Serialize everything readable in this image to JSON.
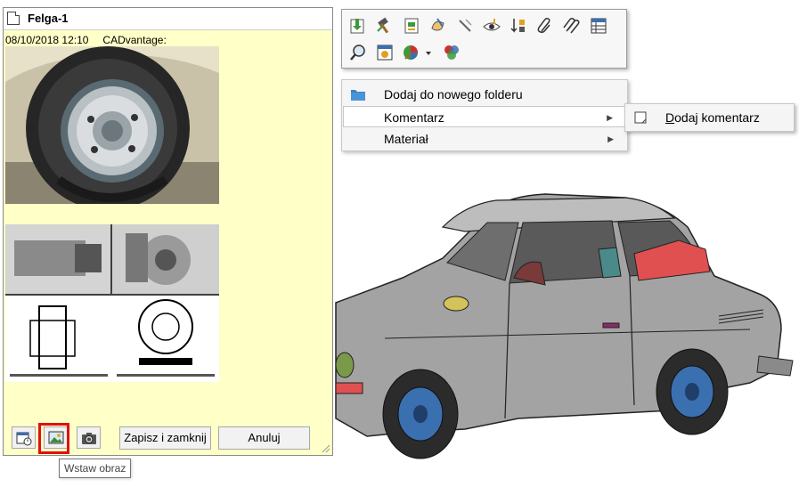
{
  "comment_window": {
    "title": "Felga-1",
    "date": "08/10/2018 12:10",
    "author": "CADvantage:",
    "buttons": {
      "save_close": "Zapisz i zamknij",
      "cancel": "Anuluj"
    },
    "tooltip": "Wstaw obraz",
    "highlight_color": "#e01010"
  },
  "context_menu": {
    "items": [
      {
        "label": "Dodaj do nowego folderu",
        "icon": "folder-icon"
      },
      {
        "label": "Komentarz",
        "icon": "",
        "has_submenu": true
      },
      {
        "label": "Materiał",
        "icon": "",
        "has_submenu": true
      }
    ],
    "submenu": {
      "label_prefix": "D",
      "label_rest": "odaj komentarz"
    }
  },
  "toolbar": {
    "icons": [
      "insert-part-icon",
      "hammer-icon",
      "document-icon",
      "hand-pen-icon",
      "pointer-hide-icon",
      "eye-icon",
      "sort-icon",
      "paperclip-icon",
      "paperclip-multi-icon",
      "table-icon",
      "zoom-icon",
      "properties-icon",
      "appearance-icon",
      "dropdown-arrow-icon",
      "color-palette-icon"
    ]
  },
  "colors": {
    "note_bg": "#ffffc8",
    "car_body": "#9a9a9a",
    "seat_red": "#e05050"
  }
}
